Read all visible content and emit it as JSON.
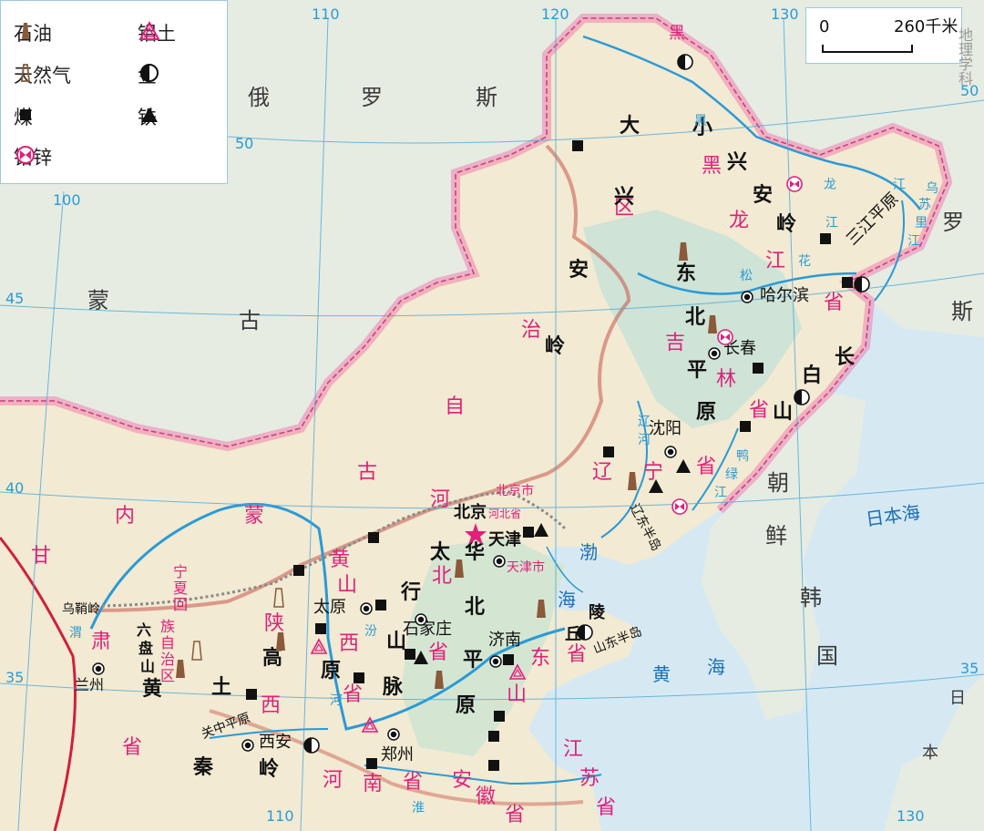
{
  "legend": {
    "items": [
      {
        "label": "石油",
        "icon": "oil-icon"
      },
      {
        "label": "铝土",
        "icon": "bauxite-icon"
      },
      {
        "label": "天然气",
        "icon": "gas-icon"
      },
      {
        "label": "金",
        "icon": "gold-icon"
      },
      {
        "label": "煤",
        "icon": "coal-icon"
      },
      {
        "label": "铁",
        "icon": "iron-icon"
      },
      {
        "label": "铅锌",
        "icon": "leadzinc-icon"
      }
    ]
  },
  "scale": {
    "zero": "0",
    "distance": "260千米"
  },
  "watermark": "地理学科",
  "grid_labels": {
    "lon_110": "110",
    "lon_120": "120",
    "lon_130": "130",
    "lon_100": "100",
    "lat_50": "50",
    "lat_45": "45",
    "lat_40": "40",
    "lat_35": "35",
    "lat_50_right": "50",
    "lat_35_right": "35",
    "lon_110_bottom": "110",
    "lon_130_bottom": "130"
  },
  "countries": {
    "russia": [
      "俄",
      "罗",
      "斯"
    ],
    "russia_right": [
      "罗",
      "斯"
    ],
    "mongolia": [
      "蒙",
      "古"
    ],
    "korea_n": [
      "朝",
      "鲜"
    ],
    "korea_s": [
      "韩",
      "国"
    ],
    "japan": [
      "日",
      "本"
    ]
  },
  "seas": {
    "japan_sea": "日本海",
    "bohai": [
      "渤",
      "海"
    ],
    "yellow_sea": [
      "黄",
      "海"
    ]
  },
  "provinces": {
    "heilongjiang": [
      "黑",
      "龙",
      "江",
      "省"
    ],
    "heilongjiang_top": "黑",
    "jilin": [
      "吉",
      "林",
      "省"
    ],
    "liaoning": [
      "辽",
      "宁",
      "省"
    ],
    "inner_mongolia": [
      "内",
      "蒙",
      "古",
      "自",
      "治",
      "区"
    ],
    "hebei": [
      "河",
      "北",
      "省"
    ],
    "beijing": "北京市",
    "tianjin": "天津市",
    "hebei_small": "河北省",
    "shanxi": [
      "山",
      "西",
      "省"
    ],
    "shaanxi": [
      "陕",
      "西"
    ],
    "shandong": [
      "山",
      "东",
      "省"
    ],
    "henan": [
      "河",
      "南",
      "省"
    ],
    "anhui": [
      "安",
      "徽",
      "省"
    ],
    "jiangsu": [
      "江",
      "苏",
      "省"
    ],
    "ningxia": [
      "宁",
      "夏",
      "回",
      "族",
      "自",
      "治",
      "区"
    ],
    "gansu": [
      "甘",
      "肃",
      "省"
    ]
  },
  "terrain": {
    "daxinganling": [
      "大",
      "兴",
      "安",
      "岭"
    ],
    "xiaoxinganling": [
      "小",
      "兴",
      "安",
      "岭"
    ],
    "dongbei_plain": [
      "东",
      "北",
      "平",
      "原"
    ],
    "changbai": [
      "长",
      "白",
      "山"
    ],
    "taihang": [
      "太",
      "行",
      "山",
      "脉"
    ],
    "huabei_plain": [
      "华",
      "北",
      "平",
      "原"
    ],
    "huangtu": [
      "黄",
      "土",
      "高",
      "原"
    ],
    "qinling": [
      "秦",
      "岭"
    ],
    "liupan": [
      "六",
      "盘",
      "山"
    ],
    "sanjiang": "三江平原",
    "guanzhong": "关中平原",
    "liaodong": "辽东半岛",
    "shandong_pen": "山东半岛",
    "qiuling": [
      "丘",
      "陵"
    ],
    "wuqiaoling": "乌鞘岭"
  },
  "rivers": {
    "heilong": [
      "黑",
      "龙",
      "江"
    ],
    "songhua": [
      "松",
      "花",
      "江"
    ],
    "wusuli": [
      "乌",
      "苏",
      "里",
      "江"
    ],
    "yalu": [
      "鸭",
      "绿",
      "江"
    ],
    "liao": [
      "辽",
      "河"
    ],
    "huang_upper": "黄",
    "huang_lower": "河",
    "fen": "汾",
    "huai": "淮",
    "wei": "渭"
  },
  "cities": {
    "beijing": "北京",
    "tianjin": "天津",
    "shenyang": "沈阳",
    "changchun": "长春",
    "harbin": "哈尔滨",
    "taiyuan": "太原",
    "shijiazhuang": "石家庄",
    "jinan": "济南",
    "zhengzhou": "郑州",
    "xian": "西安",
    "lanzhou": "兰州"
  },
  "colors": {
    "sea": "#cfe6f2",
    "land_china": "#f3ecd7",
    "land_foreign": "#e9efe9",
    "border_pink": "#f06aa6",
    "river": "#2a9ad6",
    "wall": "#c9544a",
    "province_pink": "#e0207a"
  }
}
